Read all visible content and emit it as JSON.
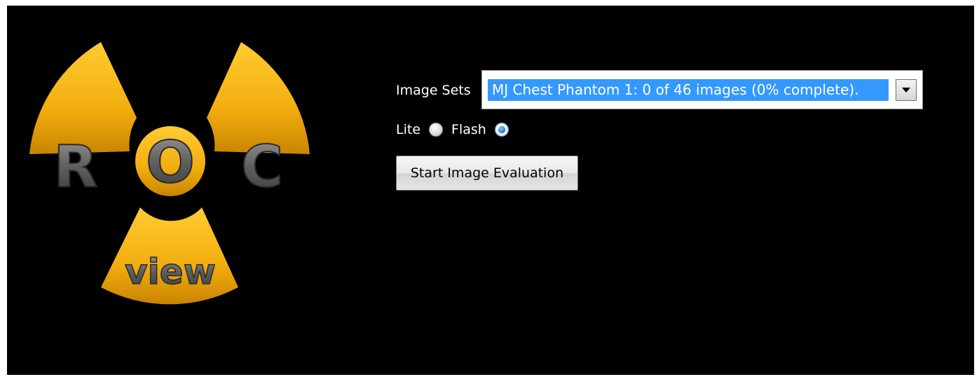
{
  "logo": {
    "letters": [
      "R",
      "O",
      "C"
    ],
    "word": "view",
    "colors": {
      "blade": "#f2ad0f",
      "letters": "#6b6b6b"
    }
  },
  "form": {
    "image_sets_label": "Image Sets",
    "image_sets_selected": "MJ Chest Phantom 1: 0 of 46 images (0% complete).",
    "mode_lite_label": "Lite",
    "mode_flash_label": "Flash",
    "selected_mode": "Flash",
    "start_button_label": "Start Image Evaluation"
  },
  "colors": {
    "background": "#000000",
    "selection_highlight": "#3399ff"
  }
}
